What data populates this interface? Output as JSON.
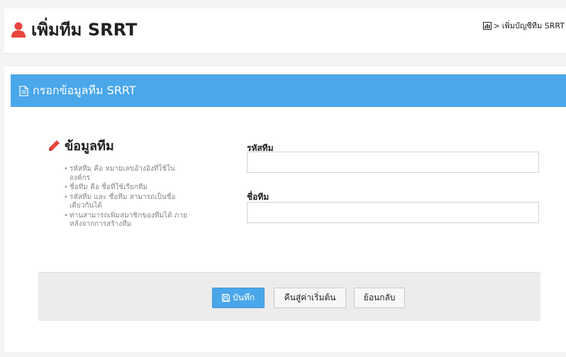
{
  "header": {
    "title": "เพิ่มทีม SRRT",
    "title_icon": "user-icon",
    "breadcrumb": {
      "icon": "bar-chart-icon",
      "separator": ">",
      "current": "เพิ่มบัญชีทีม SRRT"
    }
  },
  "panel": {
    "title": "กรอกข้อมูลทีม SRRT",
    "title_icon": "document-icon"
  },
  "section": {
    "title": "ข้อมูลทีม",
    "icon": "pencil-icon",
    "help_items": [
      "รหัสทีม คือ หมายเลขอ้างอิงที่ใช้ใน องค์กร",
      "ชื่อทีม คือ ชื่อที่ใช้เรียกทีม",
      "รหัสทีม และ ชื่อทีม สามารถเป็นชื่อ เดียวกันได้",
      "ท่านสามารถเพิ่มสมาชิกของทีมได้ ภายหลังจากการสร้างทีม"
    ]
  },
  "form": {
    "team_code": {
      "label": "รหัสทีม",
      "value": ""
    },
    "team_name": {
      "label": "ชื่อทีม",
      "value": ""
    }
  },
  "actions": {
    "save_label": "บันทึก",
    "save_icon": "floppy-disk-icon",
    "reset_label": "คืนสู่ค่าเริ่มต้น",
    "back_label": "ย้อนกลับ"
  },
  "colors": {
    "accent": "#4aa7ea",
    "user_icon": "#e8453c",
    "pencil_icon": "#e8453c"
  }
}
